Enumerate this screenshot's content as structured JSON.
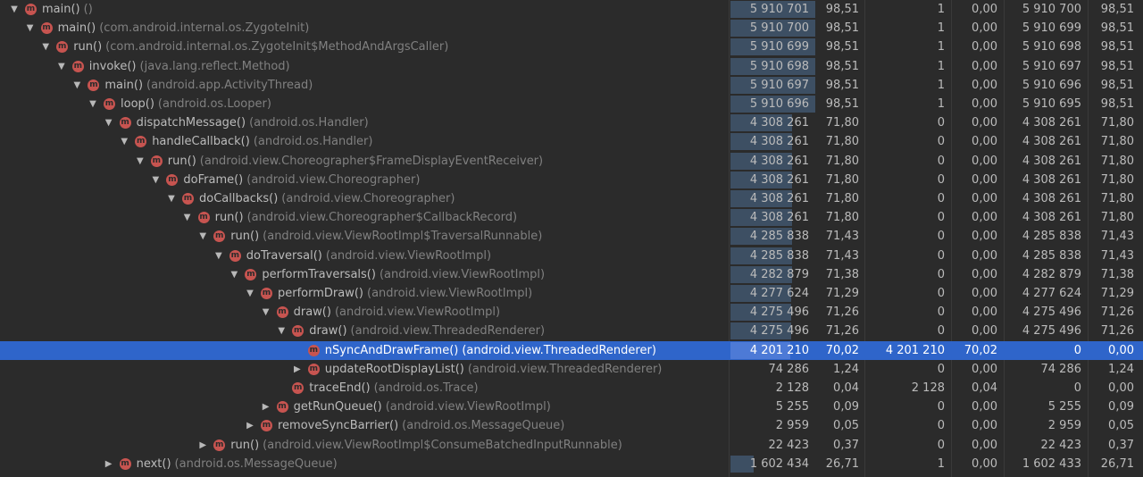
{
  "rows": [
    {
      "depth": 0,
      "arrow": "down",
      "name": "main()",
      "cls": "()",
      "total": "5 910 701",
      "total_pct": "98,51",
      "self": "1",
      "self_pct": "0,00",
      "children": "5 910 700",
      "children_pct": "98,51",
      "bar_fraction": 0.9851
    },
    {
      "depth": 1,
      "arrow": "down",
      "name": "main()",
      "cls": "(com.android.internal.os.ZygoteInit)",
      "total": "5 910 700",
      "total_pct": "98,51",
      "self": "1",
      "self_pct": "0,00",
      "children": "5 910 699",
      "children_pct": "98,51",
      "bar_fraction": 0.9851
    },
    {
      "depth": 2,
      "arrow": "down",
      "name": "run()",
      "cls": "(com.android.internal.os.ZygoteInit$MethodAndArgsCaller)",
      "total": "5 910 699",
      "total_pct": "98,51",
      "self": "1",
      "self_pct": "0,00",
      "children": "5 910 698",
      "children_pct": "98,51",
      "bar_fraction": 0.9851
    },
    {
      "depth": 3,
      "arrow": "down",
      "name": "invoke()",
      "cls": "(java.lang.reflect.Method)",
      "total": "5 910 698",
      "total_pct": "98,51",
      "self": "1",
      "self_pct": "0,00",
      "children": "5 910 697",
      "children_pct": "98,51",
      "bar_fraction": 0.9851
    },
    {
      "depth": 4,
      "arrow": "down",
      "name": "main()",
      "cls": "(android.app.ActivityThread)",
      "total": "5 910 697",
      "total_pct": "98,51",
      "self": "1",
      "self_pct": "0,00",
      "children": "5 910 696",
      "children_pct": "98,51",
      "bar_fraction": 0.9851
    },
    {
      "depth": 5,
      "arrow": "down",
      "name": "loop()",
      "cls": "(android.os.Looper)",
      "total": "5 910 696",
      "total_pct": "98,51",
      "self": "1",
      "self_pct": "0,00",
      "children": "5 910 695",
      "children_pct": "98,51",
      "bar_fraction": 0.9851
    },
    {
      "depth": 6,
      "arrow": "down",
      "name": "dispatchMessage()",
      "cls": "(android.os.Handler)",
      "total": "4 308 261",
      "total_pct": "71,80",
      "self": "0",
      "self_pct": "0,00",
      "children": "4 308 261",
      "children_pct": "71,80",
      "bar_fraction": 0.718
    },
    {
      "depth": 7,
      "arrow": "down",
      "name": "handleCallback()",
      "cls": "(android.os.Handler)",
      "total": "4 308 261",
      "total_pct": "71,80",
      "self": "0",
      "self_pct": "0,00",
      "children": "4 308 261",
      "children_pct": "71,80",
      "bar_fraction": 0.718
    },
    {
      "depth": 8,
      "arrow": "down",
      "name": "run()",
      "cls": "(android.view.Choreographer$FrameDisplayEventReceiver)",
      "total": "4 308 261",
      "total_pct": "71,80",
      "self": "0",
      "self_pct": "0,00",
      "children": "4 308 261",
      "children_pct": "71,80",
      "bar_fraction": 0.718
    },
    {
      "depth": 9,
      "arrow": "down",
      "name": "doFrame()",
      "cls": "(android.view.Choreographer)",
      "total": "4 308 261",
      "total_pct": "71,80",
      "self": "0",
      "self_pct": "0,00",
      "children": "4 308 261",
      "children_pct": "71,80",
      "bar_fraction": 0.718
    },
    {
      "depth": 10,
      "arrow": "down",
      "name": "doCallbacks()",
      "cls": "(android.view.Choreographer)",
      "total": "4 308 261",
      "total_pct": "71,80",
      "self": "0",
      "self_pct": "0,00",
      "children": "4 308 261",
      "children_pct": "71,80",
      "bar_fraction": 0.718
    },
    {
      "depth": 11,
      "arrow": "down",
      "name": "run()",
      "cls": "(android.view.Choreographer$CallbackRecord)",
      "total": "4 308 261",
      "total_pct": "71,80",
      "self": "0",
      "self_pct": "0,00",
      "children": "4 308 261",
      "children_pct": "71,80",
      "bar_fraction": 0.718
    },
    {
      "depth": 12,
      "arrow": "down",
      "name": "run()",
      "cls": "(android.view.ViewRootImpl$TraversalRunnable)",
      "total": "4 285 838",
      "total_pct": "71,43",
      "self": "0",
      "self_pct": "0,00",
      "children": "4 285 838",
      "children_pct": "71,43",
      "bar_fraction": 0.7143
    },
    {
      "depth": 13,
      "arrow": "down",
      "name": "doTraversal()",
      "cls": "(android.view.ViewRootImpl)",
      "total": "4 285 838",
      "total_pct": "71,43",
      "self": "0",
      "self_pct": "0,00",
      "children": "4 285 838",
      "children_pct": "71,43",
      "bar_fraction": 0.7143
    },
    {
      "depth": 14,
      "arrow": "down",
      "name": "performTraversals()",
      "cls": "(android.view.ViewRootImpl)",
      "total": "4 282 879",
      "total_pct": "71,38",
      "self": "0",
      "self_pct": "0,00",
      "children": "4 282 879",
      "children_pct": "71,38",
      "bar_fraction": 0.7138
    },
    {
      "depth": 15,
      "arrow": "down",
      "name": "performDraw()",
      "cls": "(android.view.ViewRootImpl)",
      "total": "4 277 624",
      "total_pct": "71,29",
      "self": "0",
      "self_pct": "0,00",
      "children": "4 277 624",
      "children_pct": "71,29",
      "bar_fraction": 0.7129
    },
    {
      "depth": 16,
      "arrow": "down",
      "name": "draw()",
      "cls": "(android.view.ViewRootImpl)",
      "total": "4 275 496",
      "total_pct": "71,26",
      "self": "0",
      "self_pct": "0,00",
      "children": "4 275 496",
      "children_pct": "71,26",
      "bar_fraction": 0.7126
    },
    {
      "depth": 17,
      "arrow": "down",
      "name": "draw()",
      "cls": "(android.view.ThreadedRenderer)",
      "total": "4 275 496",
      "total_pct": "71,26",
      "self": "0",
      "self_pct": "0,00",
      "children": "4 275 496",
      "children_pct": "71,26",
      "bar_fraction": 0.7126
    },
    {
      "depth": 18,
      "arrow": "none",
      "name": "nSyncAndDrawFrame()",
      "cls": "(android.view.ThreadedRenderer)",
      "total": "4 201 210",
      "total_pct": "70,02",
      "self": "4 201 210",
      "self_pct": "70,02",
      "children": "0",
      "children_pct": "0,00",
      "bar_fraction": 0.7002,
      "selected": true
    },
    {
      "depth": 18,
      "arrow": "right",
      "name": "updateRootDisplayList()",
      "cls": "(android.view.ThreadedRenderer)",
      "total": "74 286",
      "total_pct": "1,24",
      "self": "0",
      "self_pct": "0,00",
      "children": "74 286",
      "children_pct": "1,24",
      "bar_fraction": 0.0
    },
    {
      "depth": 17,
      "arrow": "none",
      "name": "traceEnd()",
      "cls": "(android.os.Trace)",
      "total": "2 128",
      "total_pct": "0,04",
      "self": "2 128",
      "self_pct": "0,04",
      "children": "0",
      "children_pct": "0,00",
      "bar_fraction": 0.0
    },
    {
      "depth": 16,
      "arrow": "right",
      "name": "getRunQueue()",
      "cls": "(android.view.ViewRootImpl)",
      "total": "5 255",
      "total_pct": "0,09",
      "self": "0",
      "self_pct": "0,00",
      "children": "5 255",
      "children_pct": "0,09",
      "bar_fraction": 0.0
    },
    {
      "depth": 15,
      "arrow": "right",
      "name": "removeSyncBarrier()",
      "cls": "(android.os.MessageQueue)",
      "total": "2 959",
      "total_pct": "0,05",
      "self": "0",
      "self_pct": "0,00",
      "children": "2 959",
      "children_pct": "0,05",
      "bar_fraction": 0.0
    },
    {
      "depth": 12,
      "arrow": "right",
      "name": "run()",
      "cls": "(android.view.ViewRootImpl$ConsumeBatchedInputRunnable)",
      "total": "22 423",
      "total_pct": "0,37",
      "self": "0",
      "self_pct": "0,00",
      "children": "22 423",
      "children_pct": "0,37",
      "bar_fraction": 0.0
    },
    {
      "depth": 6,
      "arrow": "right",
      "name": "next()",
      "cls": "(android.os.MessageQueue)",
      "total": "1 602 434",
      "total_pct": "26,71",
      "self": "1",
      "self_pct": "0,00",
      "children": "1 602 433",
      "children_pct": "26,71",
      "bar_fraction": 0.2671
    }
  ],
  "icon_letter": "m",
  "colors": {
    "background": "#2b2b2b",
    "selected": "#2f65ca",
    "bar": "#3d4f63",
    "method_icon": "#c75450"
  }
}
